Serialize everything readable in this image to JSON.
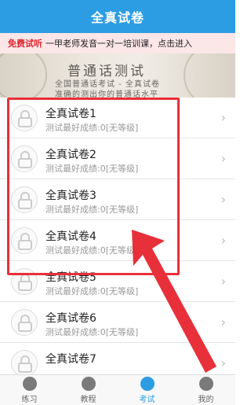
{
  "header": {
    "title": "全真试卷"
  },
  "promo": {
    "highlight": "免费试听",
    "text": "一甲老师发音一对一培训课，点击进入"
  },
  "banner": {
    "title": "普通话测试",
    "subtitle": "全国普通话考试 - 全真试卷",
    "subtitle2": "准确的测出你的普通话水平"
  },
  "papers": [
    {
      "name": "全真试卷1",
      "score": "测试最好成绩:0[无等级]"
    },
    {
      "name": "全真试卷2",
      "score": "测试最好成绩:0[无等级]"
    },
    {
      "name": "全真试卷3",
      "score": "测试最好成绩:0[无等级]"
    },
    {
      "name": "全真试卷4",
      "score": "测试最好成绩:0[无等级]"
    },
    {
      "name": "全真试卷5",
      "score": "测试最好成绩:0[无等级]"
    },
    {
      "name": "全真试卷6",
      "score": "测试最好成绩:0[无等级]"
    },
    {
      "name": "全真试卷7",
      "score": ""
    }
  ],
  "tabs": [
    {
      "label": "练习",
      "icon": "layers-icon",
      "active": false
    },
    {
      "label": "教程",
      "icon": "book-icon",
      "active": false
    },
    {
      "label": "考试",
      "icon": "document-icon",
      "active": true
    },
    {
      "label": "我的",
      "icon": "person-icon",
      "active": false
    }
  ],
  "colors": {
    "primary": "#2d9de3",
    "annotation_red": "#e8303a",
    "promo_bg": "#fbe6e8"
  }
}
